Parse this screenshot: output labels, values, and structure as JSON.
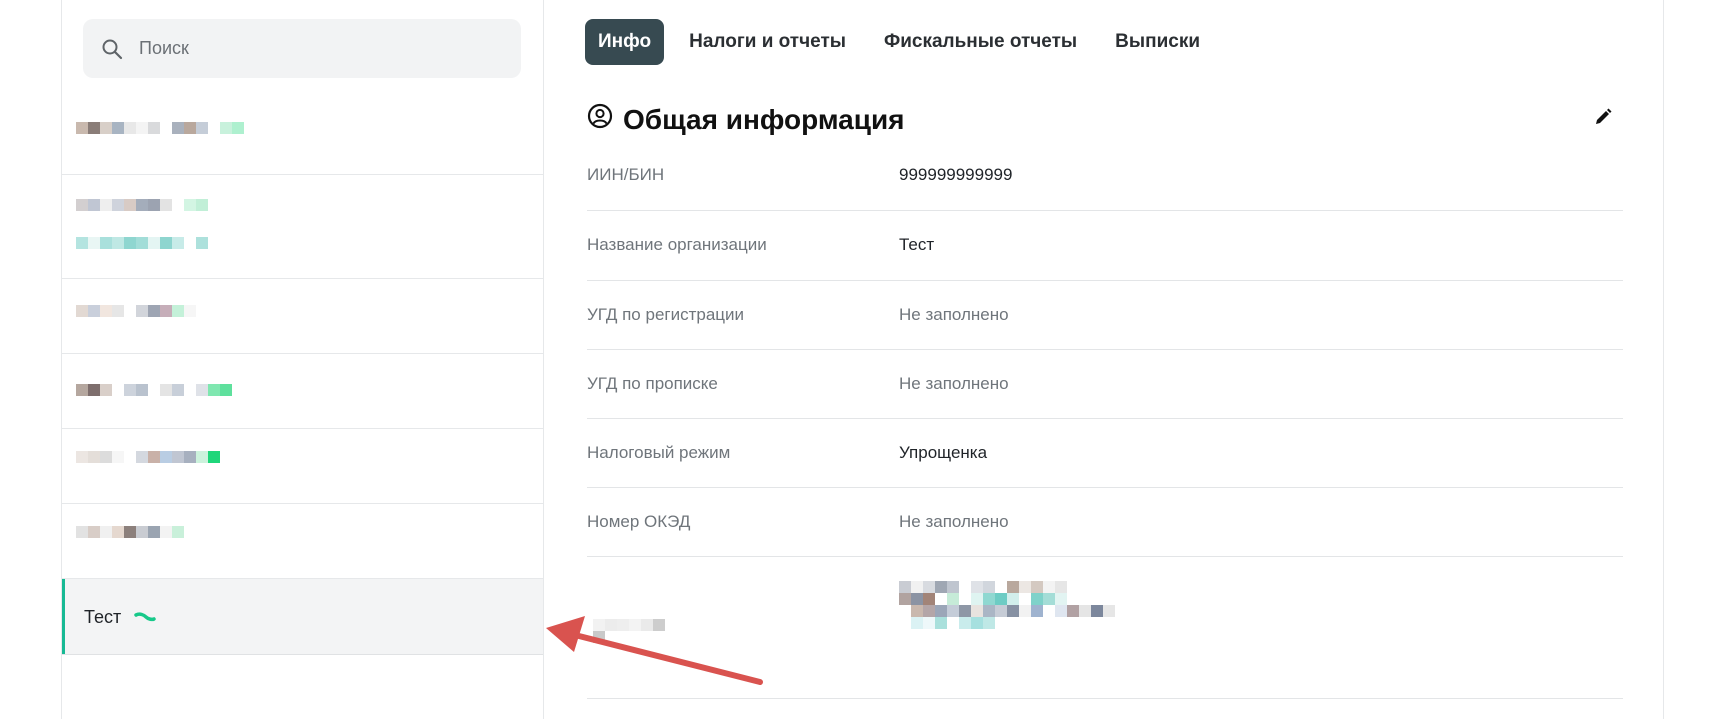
{
  "sidebar": {
    "search": {
      "placeholder": "Поиск",
      "icon": "search-icon"
    },
    "active_item": {
      "label": "Тест"
    }
  },
  "tabs": [
    {
      "label": "Инфо",
      "active": true
    },
    {
      "label": "Налоги и отчеты",
      "active": false
    },
    {
      "label": "Фискальные отчеты",
      "active": false
    },
    {
      "label": "Выписки",
      "active": false
    }
  ],
  "section": {
    "title": "Общая информация",
    "icon": "user-circle-icon",
    "edit_icon": "pencil-icon"
  },
  "fields": [
    {
      "label": "ИИН/БИН",
      "value": "999999999999"
    },
    {
      "label": "Название организации",
      "value": "Тест"
    },
    {
      "label": "УГД по регистрации",
      "value": "Не заполнено"
    },
    {
      "label": "УГД по прописке",
      "value": "Не заполнено"
    },
    {
      "label": "Налоговый режим",
      "value": "Упрощенка"
    },
    {
      "label": "Номер ОКЭД",
      "value": "Не заполнено"
    }
  ],
  "colors": {
    "accent": "#17b994",
    "tab_active_bg": "#374a51",
    "annotation_arrow": "#d9534f"
  }
}
